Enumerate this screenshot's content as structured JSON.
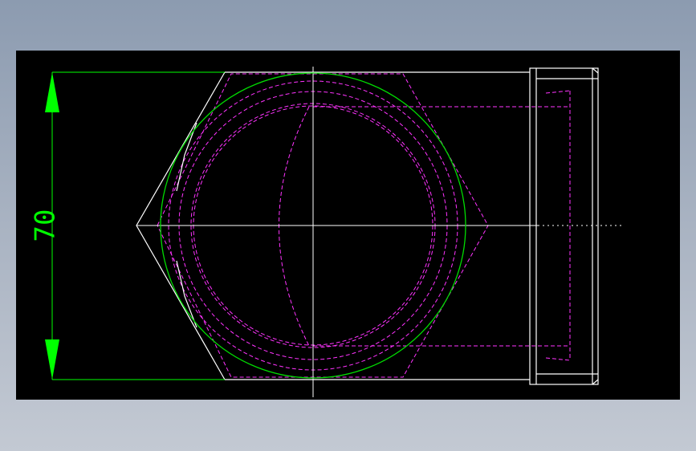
{
  "drawing": {
    "dimension_text": "70",
    "colors": {
      "background": "#000000",
      "outline": "#ffffff",
      "hidden": "#ff33ff",
      "dimension": "#00ff00",
      "circle": "#00dd00"
    }
  }
}
